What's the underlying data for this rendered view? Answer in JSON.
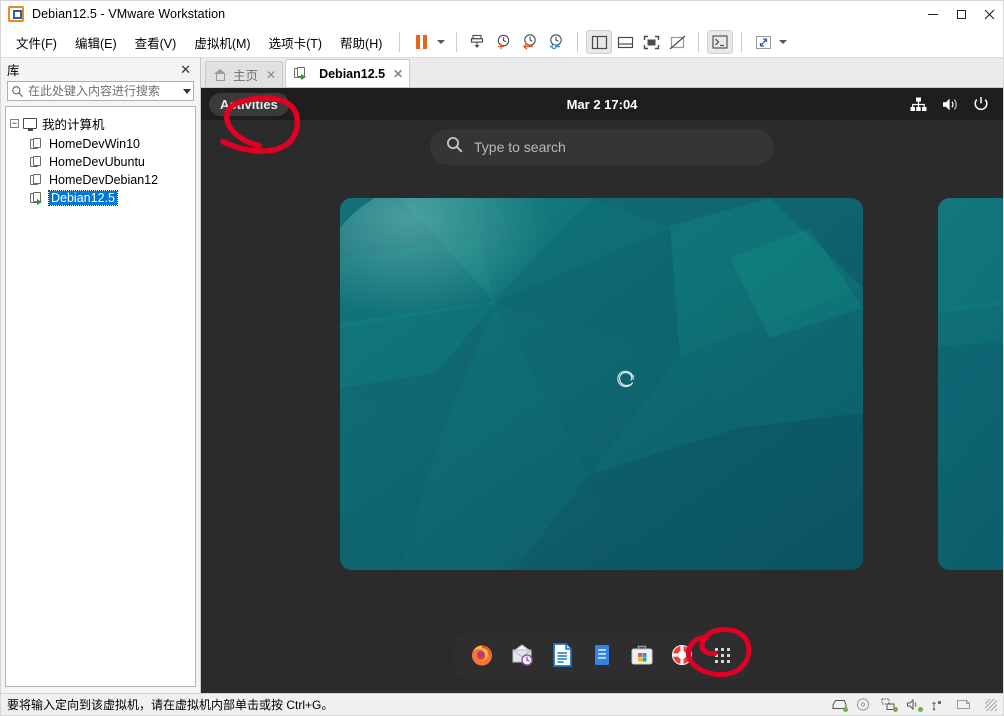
{
  "window": {
    "title": "Debian12.5  - VMware Workstation",
    "app_icon": "vmware-logo-icon",
    "controls": {
      "minimize": "–",
      "maximize": "□",
      "close": "✕"
    }
  },
  "menubar": {
    "items": [
      {
        "label": "文件(F)",
        "name": "menu-file"
      },
      {
        "label": "编辑(E)",
        "name": "menu-edit"
      },
      {
        "label": "查看(V)",
        "name": "menu-view"
      },
      {
        "label": "虚拟机(M)",
        "name": "menu-vm"
      },
      {
        "label": "选项卡(T)",
        "name": "menu-tabs"
      },
      {
        "label": "帮助(H)",
        "name": "menu-help"
      }
    ]
  },
  "toolbar": {
    "buttons": [
      {
        "name": "pause-button",
        "icon": "pause-icon",
        "color": "#e8641c"
      },
      {
        "name": "pause-dropdown",
        "icon": "chevron-down-icon"
      },
      {
        "name": "snapshot-button",
        "icon": "snapshot-icon"
      },
      {
        "name": "take-snapshot-button",
        "icon": "snapshot-add-icon"
      },
      {
        "name": "revert-snapshot-button",
        "icon": "snapshot-revert-icon"
      },
      {
        "name": "snapshot-manager-button",
        "icon": "snapshot-manager-icon"
      },
      {
        "name": "show-library-button",
        "icon": "sidebar-panel-icon",
        "active": true
      },
      {
        "name": "show-thumbnail-bar-button",
        "icon": "bottom-panel-icon"
      },
      {
        "name": "fullscreen-button",
        "icon": "fullscreen-icon"
      },
      {
        "name": "unity-mode-button",
        "icon": "unity-mode-icon"
      },
      {
        "name": "console-button",
        "icon": "terminal-icon",
        "active": true
      },
      {
        "name": "stretch-button",
        "icon": "expand-arrows-icon"
      },
      {
        "name": "stretch-dropdown",
        "icon": "chevron-down-icon"
      }
    ]
  },
  "library": {
    "header_title": "库",
    "close_label": "✕",
    "search_placeholder": "在此处键入内容进行搜索",
    "search_value": "",
    "root": {
      "label": "我的计算机",
      "expander": "−"
    },
    "items": [
      {
        "label": "HomeDevWin10",
        "running": false,
        "selected": false
      },
      {
        "label": "HomeDevUbuntu",
        "running": false,
        "selected": false
      },
      {
        "label": "HomeDevDebian12",
        "running": false,
        "selected": false
      },
      {
        "label": "Debian12.5",
        "running": true,
        "selected": true
      }
    ]
  },
  "tabs": [
    {
      "label": "主页",
      "icon": "home-icon",
      "active": false,
      "closable": true
    },
    {
      "label": "Debian12.5",
      "icon": "vm-running-icon",
      "active": true,
      "closable": true
    }
  ],
  "guest": {
    "topbar": {
      "activities_label": "Activities",
      "clock": "Mar 2  17:04",
      "tray": [
        {
          "name": "network-icon"
        },
        {
          "name": "volume-icon"
        },
        {
          "name": "power-icon"
        }
      ]
    },
    "search": {
      "placeholder": "Type to search",
      "value": "",
      "icon": "search-icon"
    },
    "workspaces": [
      {
        "name": "workspace-current",
        "wallpaper": "debian-teal-polygon"
      },
      {
        "name": "workspace-next",
        "wallpaper": "debian-teal-polygon"
      }
    ],
    "dock": [
      {
        "name": "dock-firefox",
        "label": "Firefox",
        "icon": "firefox-icon"
      },
      {
        "name": "dock-evolution",
        "label": "Evolution",
        "icon": "mail-clock-icon"
      },
      {
        "name": "dock-writer",
        "label": "LibreOffice Writer",
        "icon": "document-icon"
      },
      {
        "name": "dock-files",
        "label": "Files",
        "icon": "file-manager-icon"
      },
      {
        "name": "dock-software",
        "label": "Software",
        "icon": "software-store-icon"
      },
      {
        "name": "dock-help",
        "label": "Help",
        "icon": "lifebuoy-icon"
      },
      {
        "name": "dock-show-apps",
        "label": "Show Applications",
        "icon": "app-grid-icon"
      }
    ]
  },
  "annotations": [
    {
      "name": "annotation-activities-circle",
      "color": "#e00024",
      "target": "Activities"
    },
    {
      "name": "annotation-show-apps-circle",
      "color": "#e00024",
      "target": "Show Applications"
    }
  ],
  "statusbar": {
    "message": "要将输入定向到该虚拟机，请在虚拟机内部单击或按 Ctrl+G。",
    "icons": [
      {
        "name": "status-harddisk-icon"
      },
      {
        "name": "status-cdrom-icon"
      },
      {
        "name": "status-network-icon"
      },
      {
        "name": "status-sound-icon"
      },
      {
        "name": "status-usb-icon"
      },
      {
        "name": "status-printer-icon"
      },
      {
        "name": "status-resize-grip"
      }
    ]
  }
}
